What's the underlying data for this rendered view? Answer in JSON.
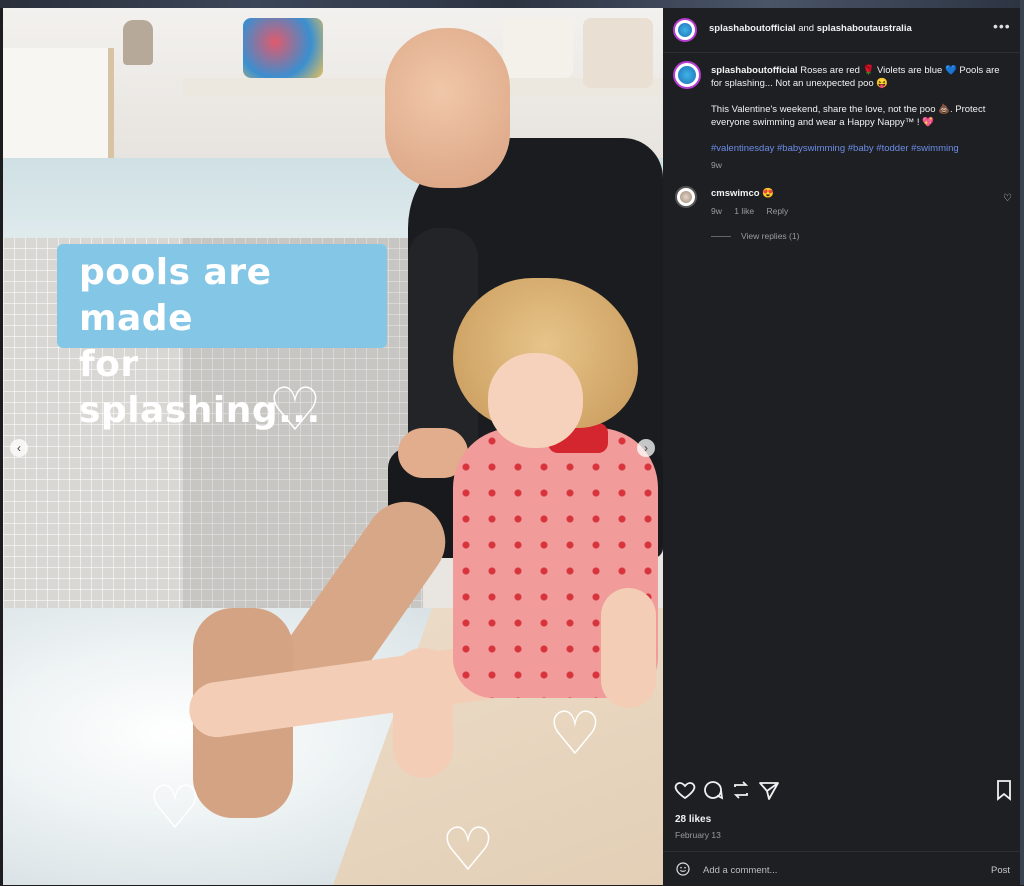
{
  "image": {
    "overlay_text_line1": "pools are made",
    "overlay_text_line2": "for splashing...",
    "prev_icon": "chevron-left-icon",
    "next_icon": "chevron-right-icon"
  },
  "header": {
    "user1": "splashaboutofficial",
    "connector": "and",
    "user2": "splashaboutaustralia",
    "more_icon": "more-dots-icon"
  },
  "caption": {
    "username": "splashaboutofficial",
    "line1": "Roses are red 🌹 Violets are blue 💙 Pools are for splashing... Not an unexpected poo 😝",
    "line2": "This Valentine's weekend, share the love, not the poo 💩. Protect everyone swimming and wear a Happy Nappy™ ! 💖",
    "hashtags": "#valentinesday #babyswimming #baby #todder #swimming",
    "age": "9w"
  },
  "comment": {
    "username": "cmswimco",
    "text": "😍",
    "age": "9w",
    "likes": "1 like",
    "reply": "Reply",
    "view_replies": "View replies (1)"
  },
  "footer": {
    "likes": "28 likes",
    "date": "February 13",
    "add_comment_placeholder": "Add a comment...",
    "post": "Post"
  },
  "colors": {
    "panel_bg": "#1e1f23",
    "hashtag": "#6c8ee8",
    "caption_box": "#84c6e6"
  }
}
